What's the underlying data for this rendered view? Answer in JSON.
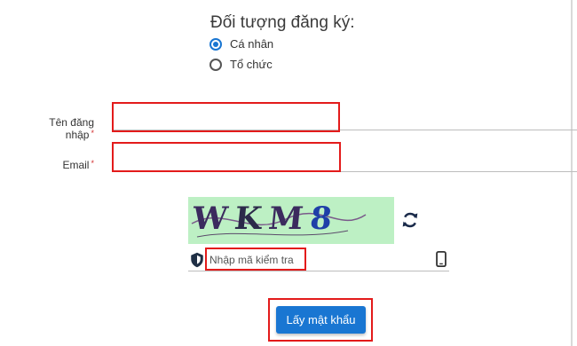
{
  "registration": {
    "title": "Đối tượng đăng ký:",
    "options": [
      {
        "label": "Cá nhân",
        "selected": true
      },
      {
        "label": "Tổ chức",
        "selected": false
      }
    ]
  },
  "form": {
    "username_label": "Tên đăng nhập",
    "email_label": "Email",
    "required_marker": "*",
    "username_value": "",
    "email_value": ""
  },
  "captcha": {
    "text": [
      "W",
      "K",
      "M",
      "8"
    ],
    "placeholder": "Nhập mã kiểm tra",
    "refresh_icon": "refresh-icon",
    "shield_icon": "shield-icon",
    "phone_icon": "phone-icon"
  },
  "submit": {
    "label": "Lấy mật khẩu"
  },
  "colors": {
    "accent": "#1976d2",
    "highlight_box": "#e31b1b",
    "captcha_bg": "#bdf0c4",
    "required": "#d32f2f"
  }
}
